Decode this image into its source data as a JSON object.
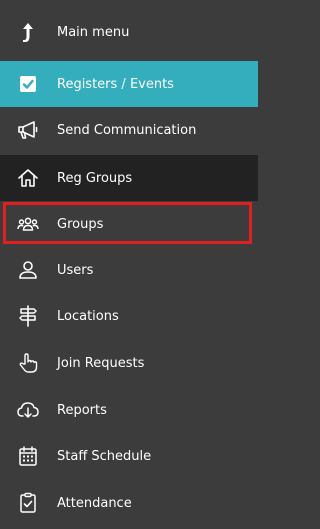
{
  "menu": {
    "items": [
      {
        "label": "Main menu",
        "icon": "up-arrow-icon"
      },
      {
        "label": "Registers / Events",
        "icon": "checkbox-icon"
      },
      {
        "label": "Send Communication",
        "icon": "megaphone-icon"
      },
      {
        "label": "Reg Groups",
        "icon": "home-icon"
      },
      {
        "label": "Groups",
        "icon": "people-group-icon"
      },
      {
        "label": "Users",
        "icon": "user-icon"
      },
      {
        "label": "Locations",
        "icon": "signpost-icon"
      },
      {
        "label": "Join Requests",
        "icon": "hand-pointer-icon"
      },
      {
        "label": "Reports",
        "icon": "cloud-download-icon"
      },
      {
        "label": "Staff Schedule",
        "icon": "calendar-icon"
      },
      {
        "label": "Attendance",
        "icon": "clipboard-check-icon"
      }
    ]
  },
  "colors": {
    "background": "#3c3c3c",
    "active": "#34aebc",
    "dark_row": "#222222",
    "highlight_border": "#e02020"
  }
}
